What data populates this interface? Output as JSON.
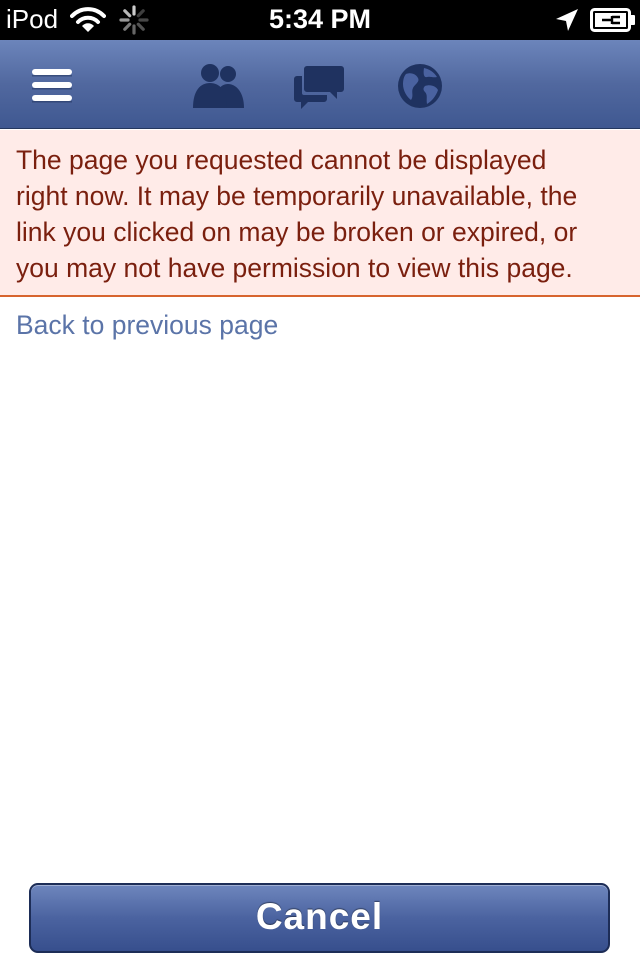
{
  "status_bar": {
    "device": "iPod",
    "time": "5:34 PM",
    "icons": [
      "wifi-icon",
      "activity-spinner-icon",
      "location-arrow-icon",
      "battery-charging-icon"
    ]
  },
  "nav_bar": {
    "background_color": "#4f669e",
    "icons": [
      "menu-icon",
      "friend-requests-icon",
      "messages-icon",
      "notifications-globe-icon"
    ]
  },
  "error": {
    "lines": [
      "The page you requested cannot be displayed",
      "right now. It may be temporarily unavailable, the",
      "link you clicked on may be broken or expired, or",
      "you may not have permission to view this page."
    ],
    "background_color": "#ffebe8",
    "text_color": "#7a1f0e",
    "border_color": "#d7642e"
  },
  "back_link": {
    "label": "Back to previous page",
    "color": "#5b74a8"
  },
  "cancel_button": {
    "label": "Cancel"
  }
}
